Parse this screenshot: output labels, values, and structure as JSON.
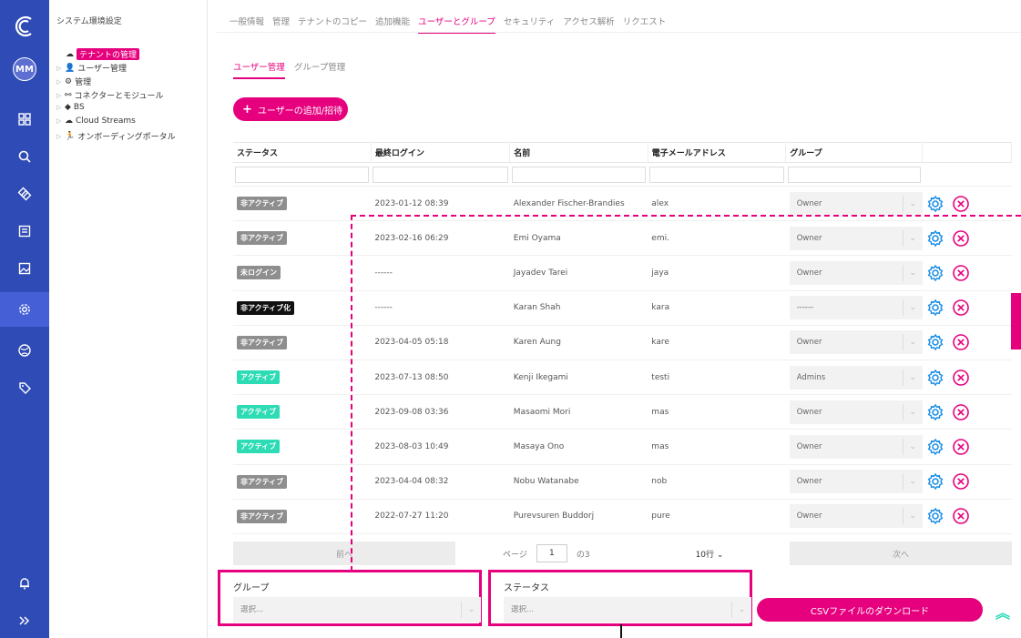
{
  "rail": {
    "avatar": "MM"
  },
  "tree": {
    "title": "システム環境設定",
    "items": [
      {
        "label": "テナントの管理",
        "icon": "cloud-icon",
        "selected": true
      },
      {
        "label": "ユーザー管理",
        "icon": "user-icon"
      },
      {
        "label": "管理",
        "icon": "gear-icon"
      },
      {
        "label": "コネクターとモジュール",
        "icon": "connector-icon"
      },
      {
        "label": "BS",
        "icon": "cube-icon"
      },
      {
        "label": "Cloud Streams",
        "icon": "cloud-icon"
      },
      {
        "label": "オンボーディングポータル",
        "icon": "person-run-icon"
      }
    ]
  },
  "topnav": [
    "一般情報",
    "管理",
    "テナントのコピー",
    "追加機能",
    "ユーザーとグループ",
    "セキュリティ",
    "アクセス解析",
    "リクエスト"
  ],
  "subnav": [
    "ユーザー管理",
    "グループ管理"
  ],
  "add_button": "ユーザーの追加/招待",
  "table": {
    "headers": [
      "ステータス",
      "最終ログイン",
      "名前",
      "電子メールアドレス",
      "グループ"
    ],
    "rows": [
      {
        "status": "非アクティブ",
        "status_color": "gray",
        "last_login": "2023-01-12 08:39",
        "name": "Alexander Fischer-Brandies",
        "email": "alex",
        "group": "Owner"
      },
      {
        "status": "非アクティブ",
        "status_color": "gray",
        "last_login": "2023-02-16 06:29",
        "name": "Emi Oyama",
        "email": "emi.",
        "group": "Owner"
      },
      {
        "status": "未ログイン",
        "status_color": "gray",
        "last_login": "------",
        "name": "Jayadev Tarei",
        "email": "jaya",
        "group": "Owner"
      },
      {
        "status": "非アクティブ化",
        "status_color": "black",
        "last_login": "------",
        "name": "Karan Shah",
        "email": "kara",
        "group": "------"
      },
      {
        "status": "非アクティブ",
        "status_color": "gray",
        "last_login": "2023-04-05 05:18",
        "name": "Karen Aung",
        "email": "kare",
        "group": "Owner"
      },
      {
        "status": "アクティブ",
        "status_color": "green",
        "last_login": "2023-07-13 08:50",
        "name": "Kenji Ikegami",
        "email": "testi",
        "group": "Admins"
      },
      {
        "status": "アクティブ",
        "status_color": "green",
        "last_login": "2023-09-08 03:36",
        "name": "Masaomi Mori",
        "email": "mas",
        "group": "Owner"
      },
      {
        "status": "アクティブ",
        "status_color": "green",
        "last_login": "2023-08-03 10:49",
        "name": "Masaya Ono",
        "email": "mas",
        "group": "Owner"
      },
      {
        "status": "非アクティブ",
        "status_color": "gray",
        "last_login": "2023-04-04 08:32",
        "name": "Nobu Watanabe",
        "email": "nob",
        "group": "Owner"
      },
      {
        "status": "非アクティブ",
        "status_color": "gray",
        "last_login": "2022-07-27 11:20",
        "name": "Purevsuren Buddorj",
        "email": "pure",
        "group": "Owner"
      }
    ]
  },
  "pager": {
    "prev": "前へ",
    "page_label": "ページ",
    "page": "1",
    "of": "の3",
    "rows": "10行 ⌄",
    "next": "次へ"
  },
  "filters": {
    "group_label": "グループ",
    "group_placeholder": "選択...",
    "status_label": "ステータス",
    "status_placeholder": "選択..."
  },
  "csv_button": "CSVファイルのダウンロード",
  "colors": {
    "accent": "#e6007e",
    "rail": "#2f4bb5",
    "active": "#2ddbb5"
  }
}
